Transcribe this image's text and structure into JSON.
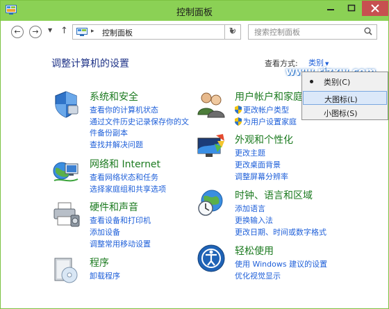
{
  "window": {
    "title": "控制面板"
  },
  "address": {
    "location": "控制面板"
  },
  "search": {
    "placeholder": "搜索控制面板"
  },
  "main": {
    "heading": "调整计算机的设置",
    "view_label": "查看方式:",
    "view_value": "类别"
  },
  "categories": {
    "system": {
      "title": "系统和安全",
      "links": [
        "查看你的计算机状态",
        "通过文件历史记录保存你的文",
        "件备份副本",
        "查找并解决问题"
      ]
    },
    "network": {
      "title": "网络和 Internet",
      "links": [
        "查看网络状态和任务",
        "选择家庭组和共享选项"
      ]
    },
    "hardware": {
      "title": "硬件和声音",
      "links": [
        "查看设备和打印机",
        "添加设备",
        "调整常用移动设置"
      ]
    },
    "programs": {
      "title": "程序",
      "links": [
        "卸载程序"
      ]
    },
    "users": {
      "title": "用户帐户和家庭",
      "links": [
        "更改帐户类型",
        "为用户设置家庭"
      ]
    },
    "appearance": {
      "title": "外观和个性化",
      "links": [
        "更改主题",
        "更改桌面背景",
        "调整屏幕分辨率"
      ]
    },
    "clock": {
      "title": "时钟、语言和区域",
      "links": [
        "添加语言",
        "更换输入法",
        "更改日期、时间或数字格式"
      ]
    },
    "ease": {
      "title": "轻松使用",
      "links": [
        "使用 Windows 建议的设置",
        "优化视觉显示"
      ]
    }
  },
  "view_menu": {
    "items": [
      "类别(C)",
      "大图标(L)",
      "小图标(S)"
    ],
    "selected": "类别(C)",
    "highlighted": "大图标(L)"
  },
  "watermark": "www.rjzxw.com",
  "colors": {
    "titlebar": "#8bd155",
    "link": "#1e5fd9",
    "category": "#1b7a1f",
    "heading": "#1e3287"
  }
}
